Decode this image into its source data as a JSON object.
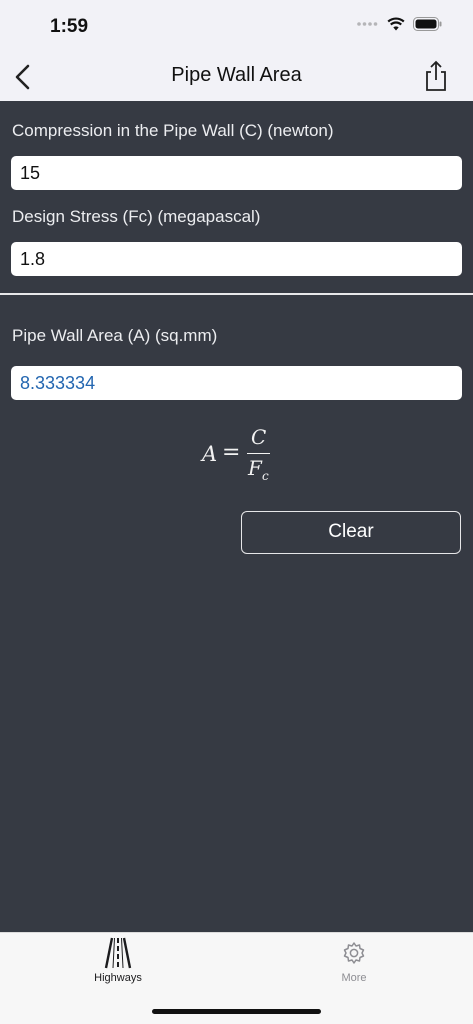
{
  "status_bar": {
    "time": "1:59"
  },
  "nav": {
    "title": "Pipe Wall Area"
  },
  "inputs": [
    {
      "label": "Compression in the Pipe Wall (C) (newton)",
      "value": "15"
    },
    {
      "label": "Design Stress (Fc) (megapascal)",
      "value": "1.8"
    }
  ],
  "result": {
    "label": "Pipe Wall Area (A) (sq.mm)",
    "value": "8.333334"
  },
  "formula": {
    "lhs": "A",
    "equals": "=",
    "numerator": "C",
    "denominator": "F",
    "subscript": "c"
  },
  "actions": {
    "clear_label": "Clear"
  },
  "tabs": [
    {
      "label": "Highways",
      "icon": "road-icon",
      "active": true,
      "color": "#1c1c1e"
    },
    {
      "label": "More",
      "icon": "gear-icon",
      "active": false,
      "color": "#8e8e93"
    }
  ]
}
